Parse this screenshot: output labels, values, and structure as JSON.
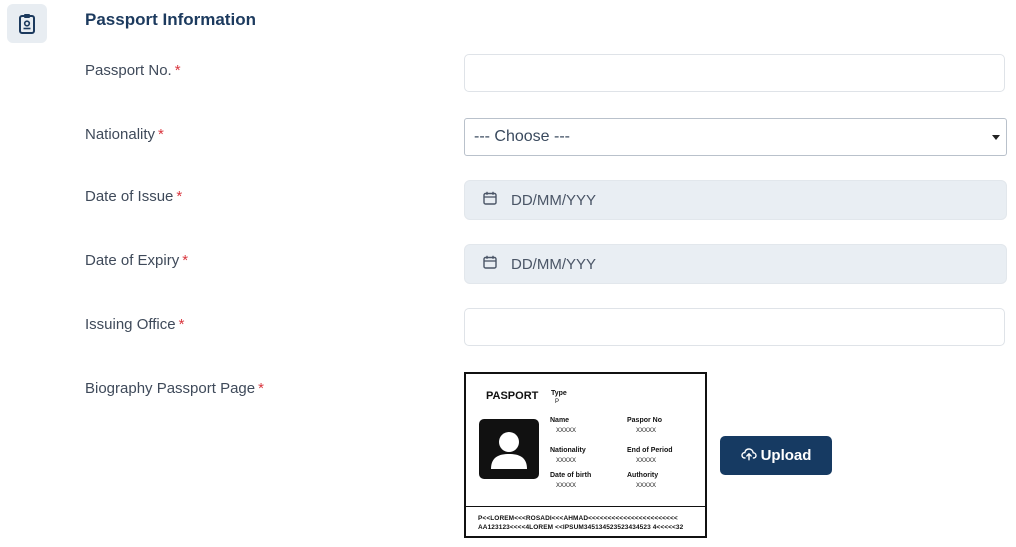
{
  "section": {
    "title": "Passport Information",
    "icon": "passport-id-icon"
  },
  "required_mark": "*",
  "fields": {
    "passport_no": {
      "label": "Passport No.",
      "value": ""
    },
    "nationality": {
      "label": "Nationality",
      "selected": "--- Choose ---"
    },
    "date_of_issue": {
      "label": "Date of Issue",
      "placeholder": "DD/MM/YYY",
      "icon": "calendar-icon"
    },
    "date_of_expiry": {
      "label": "Date of Expiry",
      "placeholder": "DD/MM/YYY",
      "icon": "calendar-icon"
    },
    "issuing_office": {
      "label": "Issuing Office",
      "value": ""
    },
    "biography_page": {
      "label": "Biography Passport Page"
    }
  },
  "passport_sample": {
    "title": "PASPORT",
    "type_label": "Type",
    "type_value": "P",
    "name_label": "Name",
    "name_value": "XXXXX",
    "passport_no_label": "Paspor No",
    "passport_no_value": "XXXXX",
    "nationality_label": "Nationality",
    "nationality_value": "XXXXX",
    "end_period_label": "End of Period",
    "end_period_value": "XXXXX",
    "dob_label": "Date of birth",
    "dob_value": "XXXXX",
    "authority_label": "Authority",
    "authority_value": "XXXXX",
    "mrz_line1": "P<<LOREM<<<ROSADI<<<AHMAD<<<<<<<<<<<<<<<<<<<<<<<",
    "mrz_line2": "AA123123<<<<4LOREM <<IPSUM345134523523434523 4<<<<<32"
  },
  "upload_button": {
    "label": "Upload",
    "icon": "cloud-upload-icon"
  },
  "colors": {
    "primary": "#163a62",
    "required": "#d9363e",
    "title": "#1c3a5e",
    "date_bg": "#e9eef3"
  }
}
